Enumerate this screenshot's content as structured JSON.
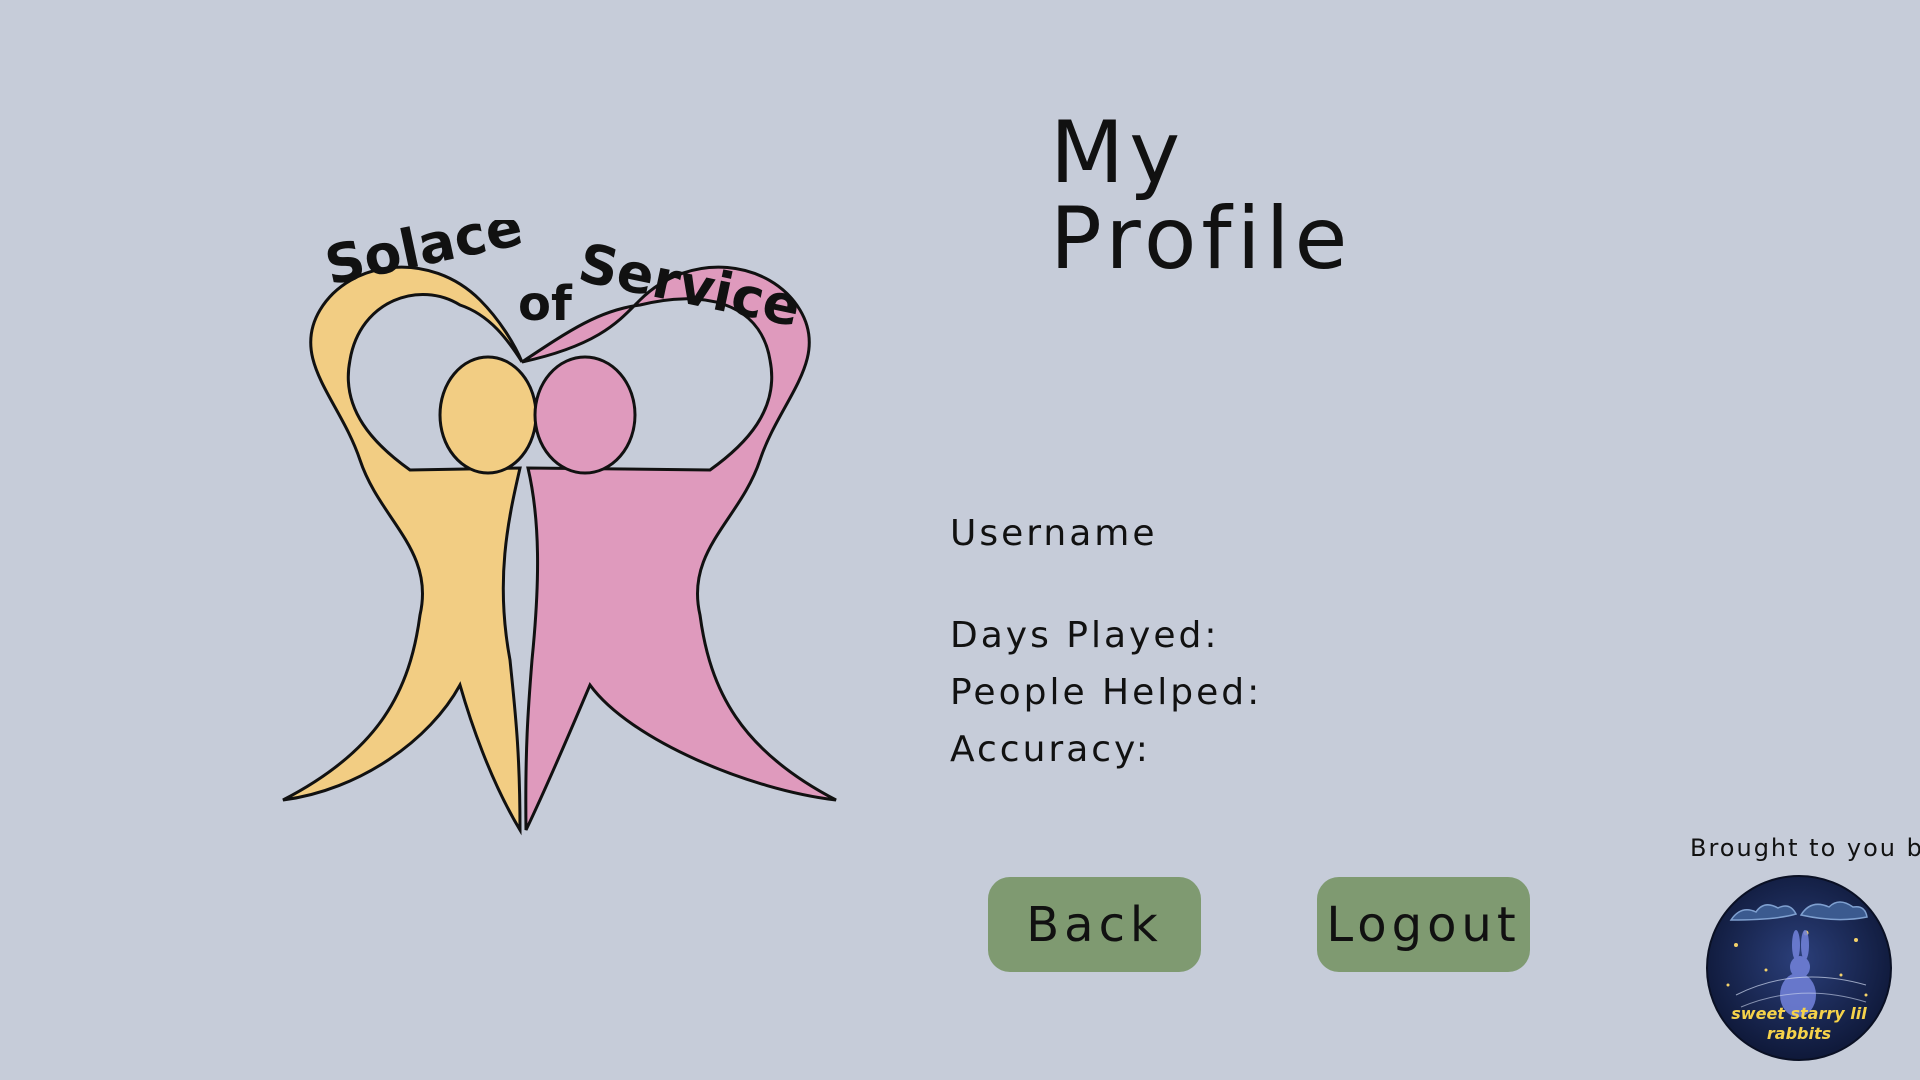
{
  "profile": {
    "title": "My Profile",
    "username_label": "Username",
    "days_played_label": "Days Played:",
    "people_helped_label": "People Helped:",
    "accuracy_label": "Accuracy:"
  },
  "logo": {
    "word_left": "Solace",
    "word_mid": "of",
    "word_right": "Service",
    "colors": {
      "yellow": "#f2cd83",
      "pink": "#df9abd",
      "outline": "#111111"
    }
  },
  "buttons": {
    "back_label": "Back",
    "logout_label": "Logout",
    "color": "#7f9a71"
  },
  "credits": {
    "brought_label": "Brought to you by:",
    "badge_line1": "sweet starry lil",
    "badge_line2": "rabbits"
  },
  "theme": {
    "background": "#c6ccd9"
  }
}
